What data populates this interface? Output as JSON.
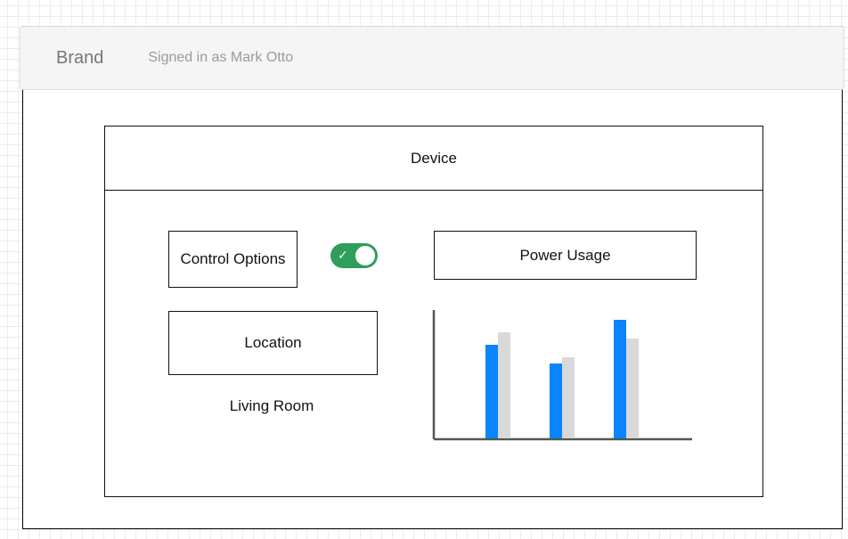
{
  "navbar": {
    "brand": "Brand",
    "signed_in": "Signed in as Mark Otto"
  },
  "card": {
    "title": "Device",
    "control_options_label": "Control Options",
    "toggle": {
      "checked": true,
      "icon": "check-icon",
      "color": "#2e9e5b"
    },
    "location_label": "Location",
    "location_value": "Living Room",
    "power_usage_label": "Power Usage"
  },
  "chart_data": {
    "type": "bar",
    "categories": [
      "",
      "",
      ""
    ],
    "series": [
      {
        "values": [
          75,
          60,
          95
        ],
        "color": "#0a84ff"
      },
      {
        "values": [
          85,
          65,
          80
        ],
        "color": "#d9d9d9"
      }
    ],
    "ylim": [
      0,
      100
    ],
    "title": "",
    "xlabel": "",
    "ylabel": "",
    "grid": false
  }
}
